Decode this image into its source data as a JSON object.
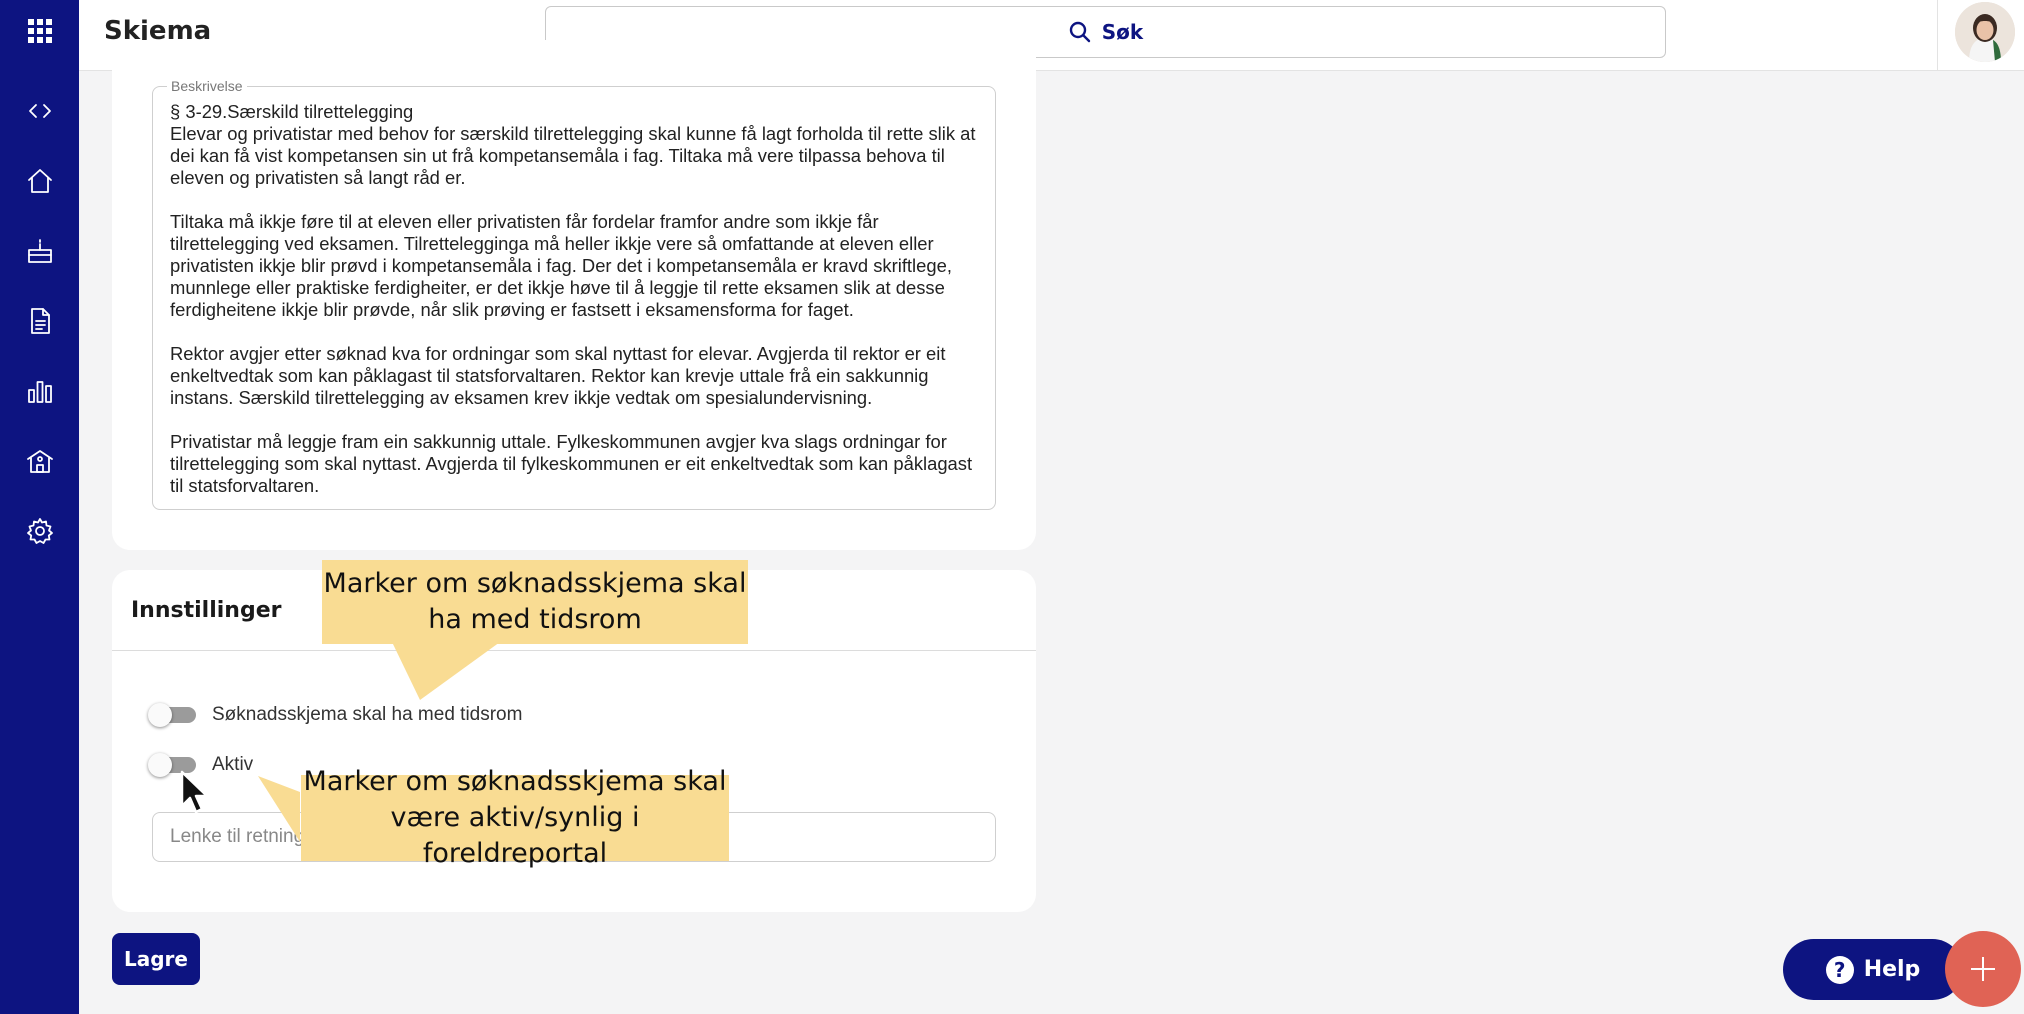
{
  "header": {
    "title": "Skjema",
    "search_label": "Søk"
  },
  "sidebar": {
    "items": [
      {
        "icon": "apps-grid-icon"
      },
      {
        "icon": "code-icon"
      },
      {
        "icon": "home-icon"
      },
      {
        "icon": "cake-icon"
      },
      {
        "icon": "document-icon"
      },
      {
        "icon": "bar-chart-icon"
      },
      {
        "icon": "school-icon"
      },
      {
        "icon": "gear-icon"
      }
    ]
  },
  "description": {
    "legend": "Beskrivelse",
    "paragraphs": [
      "§ 3-29.Særskild tilrettelegging\nElevar og privatistar med behov for særskild tilrettelegging skal kunne få lagt forholda til rette slik at dei kan få vist kompetansen sin ut frå kompetansemåla i fag. Tiltaka må vere tilpassa behova til eleven og privatisten så langt råd er.",
      "Tiltaka må ikkje føre til at eleven eller privatisten får fordelar framfor andre som ikkje får tilrettelegging ved eksamen. Tilrettelegginga må heller ikkje vere så omfattande at eleven eller privatisten ikkje blir prøvd i kompetansemåla i fag. Der det i kompetansemåla er kravd skriftlege, munnlege eller praktiske ferdigheiter, er det ikkje høve til å leggje til rette eksamen slik at desse ferdigheitene ikkje blir prøvde, når slik prøving er fastsett i eksamensforma for faget.",
      "Rektor avgjer etter søknad kva for ordningar som skal nyttast for elevar. Avgjerda til rektor er eit enkeltvedtak som kan påklagast til statsforvaltaren. Rektor kan krevje uttale frå ein sakkunnig instans. Særskild tilrettelegging av eksamen krev ikkje vedtak om spesialundervisning.",
      "Privatistar må leggje fram ein sakkunnig uttale. Fylkeskommunen avgjer kva slags ordningar for tilrettelegging som skal nyttast. Avgjerda til fylkeskommunen er eit enkeltvedtak som kan påklagast til statsforvaltaren."
    ]
  },
  "settings": {
    "title": "Innstillinger",
    "toggle_period_label": "Søknadsskjema skal ha med tidsrom",
    "toggle_period_on": false,
    "toggle_active_label": "Aktiv",
    "toggle_active_on": false,
    "link_placeholder": "Lenke til retningslinjer"
  },
  "save_label": "Lagre",
  "help_label": "Help",
  "help_icon_glyph": "?",
  "callouts": {
    "period": "Marker om søknadsskjema skal ha med tidsrom",
    "active": "Marker om søknadsskjema skal være aktiv/synlig i foreldreportal"
  },
  "colors": {
    "brand": "#0d1481",
    "callout": "#f9dc93",
    "fab": "#e06355"
  }
}
